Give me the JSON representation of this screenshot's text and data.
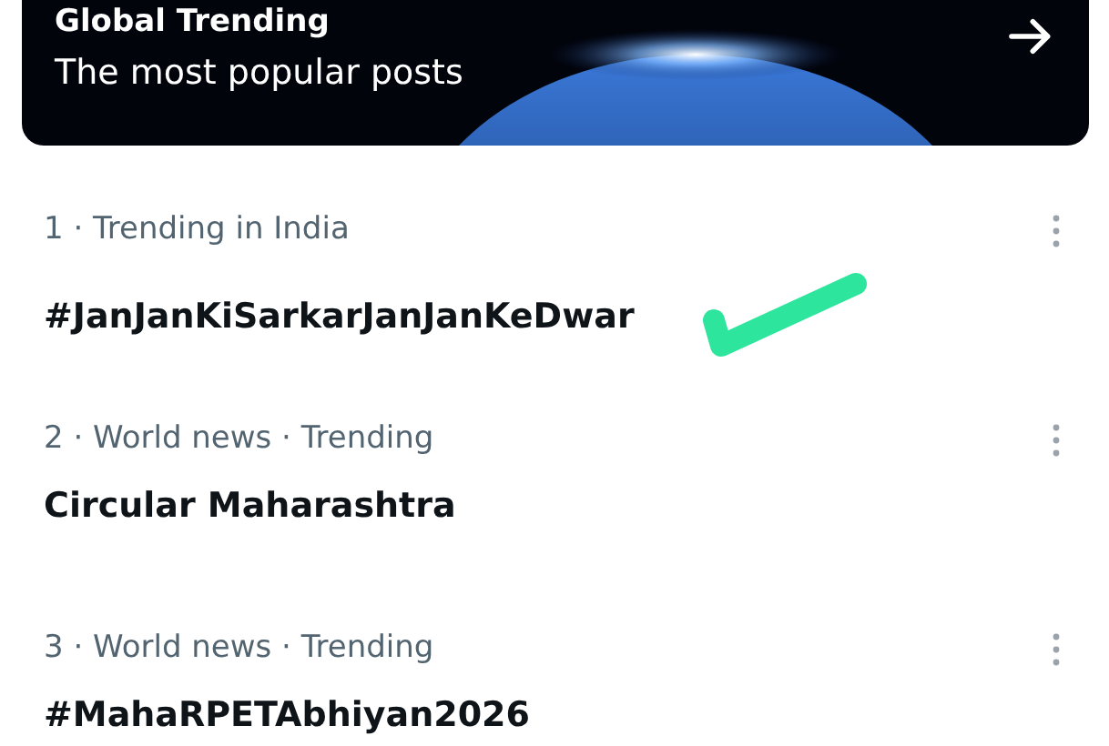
{
  "banner": {
    "title": "Global Trending",
    "subtitle": "The most popular posts"
  },
  "trends": [
    {
      "meta": "1 · Trending in India",
      "name": "#JanJanKiSarkarJanJanKeDwar",
      "marked": true
    },
    {
      "meta": "2 · World news · Trending",
      "name": "Circular Maharashtra",
      "marked": false
    },
    {
      "meta": "3 · World news · Trending",
      "name": "#MahaRPETAbhiyan2026",
      "marked": false
    }
  ]
}
